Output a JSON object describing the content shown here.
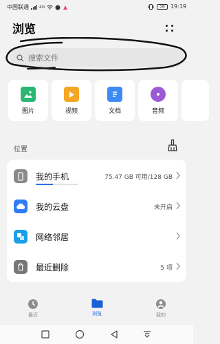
{
  "status_bar": {
    "carrier": "中国联通",
    "network": "4G",
    "battery": "58",
    "time": "19:19"
  },
  "header": {
    "title": "浏览",
    "more_icon": "more-dots-icon"
  },
  "search": {
    "placeholder": "搜索文件"
  },
  "categories": [
    {
      "label": "图片",
      "icon": "image-icon",
      "color": "#2bb673"
    },
    {
      "label": "视频",
      "icon": "video-icon",
      "color": "#f5a623"
    },
    {
      "label": "文档",
      "icon": "document-icon",
      "color": "#3d8af7"
    },
    {
      "label": "音频",
      "icon": "audio-icon",
      "color": "#9b59d6"
    }
  ],
  "locations": {
    "title": "位置",
    "items": [
      {
        "label": "我的手机",
        "value": "75.47 GB 可用/128 GB",
        "icon": "phone-icon",
        "color": "#8a8a8a",
        "used_fraction": 0.41
      },
      {
        "label": "我的云盘",
        "value": "未开启",
        "icon": "cloud-icon",
        "color": "#2f7df6"
      },
      {
        "label": "网络邻居",
        "value": "",
        "icon": "network-neighbor-icon",
        "color": "#1aa0e8"
      },
      {
        "label": "最近删除",
        "value": "5 项",
        "icon": "trash-icon",
        "color": "#777777"
      }
    ]
  },
  "tabs": [
    {
      "label": "最近",
      "icon": "recent-icon",
      "active": false
    },
    {
      "label": "浏览",
      "icon": "folder-icon",
      "active": true
    },
    {
      "label": "我的",
      "icon": "profile-icon",
      "active": false
    }
  ],
  "accent_color": "#1a5fd6"
}
